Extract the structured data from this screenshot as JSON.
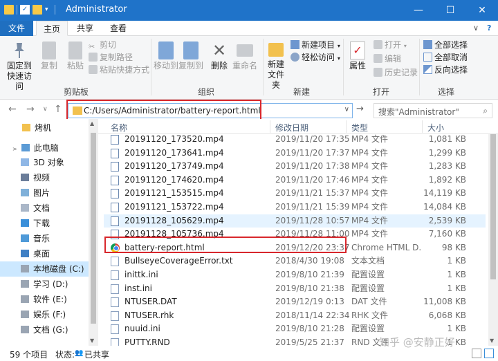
{
  "window": {
    "title": "Administrator",
    "minimize": "—",
    "maximize": "☐",
    "close": "✕"
  },
  "ribbon_tabs": {
    "file": "文件",
    "home": "主页",
    "share": "共享",
    "view": "查看",
    "collapse": "∨",
    "help": "?"
  },
  "ribbon": {
    "clipboard": {
      "label": "剪贴板",
      "pin": "固定到\n快速访问",
      "pin_l1": "固定到",
      "pin_l2": "快速访问",
      "copy": "复制",
      "paste": "粘贴",
      "cut": "剪切",
      "copy_path": "复制路径",
      "paste_shortcut": "粘贴快捷方式"
    },
    "organize": {
      "label": "组织",
      "move_to": "移动到",
      "copy_to": "复制到",
      "delete": "删除",
      "rename": "重命名"
    },
    "new": {
      "label": "新建",
      "new_folder_l1": "新建",
      "new_folder_l2": "文件夹",
      "new_item": "新建项目",
      "easy_access": "轻松访问"
    },
    "open": {
      "label": "打开",
      "properties": "属性",
      "open": "打开",
      "edit": "编辑",
      "history": "历史记录"
    },
    "select": {
      "label": "选择",
      "select_all": "全部选择",
      "select_none": "全部取消",
      "invert": "反向选择"
    }
  },
  "address": {
    "path": "C:/Users/Administrator/battery-report.html",
    "search_placeholder": "搜索\"Administrator\""
  },
  "nav_pane": [
    {
      "label": "烤机",
      "icon": "folder-icon"
    },
    {
      "label": "此电脑",
      "icon": "computer-icon"
    },
    {
      "label": "3D 对象",
      "icon": "3d-objects-icon"
    },
    {
      "label": "视频",
      "icon": "video-icon"
    },
    {
      "label": "图片",
      "icon": "pictures-icon"
    },
    {
      "label": "文档",
      "icon": "documents-icon"
    },
    {
      "label": "下载",
      "icon": "download-icon"
    },
    {
      "label": "音乐",
      "icon": "music-icon"
    },
    {
      "label": "桌面",
      "icon": "desktop-icon"
    },
    {
      "label": "本地磁盘 (C:)",
      "icon": "drive-icon"
    },
    {
      "label": "学习 (D:)",
      "icon": "drive-icon"
    },
    {
      "label": "软件 (E:)",
      "icon": "drive-icon"
    },
    {
      "label": "娱乐 (F:)",
      "icon": "drive-icon"
    },
    {
      "label": "文档 (G:)",
      "icon": "drive-icon"
    }
  ],
  "columns": {
    "name": "名称",
    "date": "修改日期",
    "type": "类型",
    "size": "大小"
  },
  "files": [
    {
      "name": "20191120_173520.mp4",
      "date": "2019/11/20 17:35",
      "type": "MP4 文件",
      "size": "1,081 KB"
    },
    {
      "name": "20191120_173641.mp4",
      "date": "2019/11/20 17:37",
      "type": "MP4 文件",
      "size": "1,299 KB"
    },
    {
      "name": "20191120_173749.mp4",
      "date": "2019/11/20 17:38",
      "type": "MP4 文件",
      "size": "1,283 KB"
    },
    {
      "name": "20191120_174620.mp4",
      "date": "2019/11/20 17:46",
      "type": "MP4 文件",
      "size": "1,892 KB"
    },
    {
      "name": "20191121_153515.mp4",
      "date": "2019/11/21 15:37",
      "type": "MP4 文件",
      "size": "14,119 KB"
    },
    {
      "name": "20191121_153722.mp4",
      "date": "2019/11/21 15:39",
      "type": "MP4 文件",
      "size": "14,084 KB"
    },
    {
      "name": "20191128_105629.mp4",
      "date": "2019/11/28 10:57",
      "type": "MP4 文件",
      "size": "2,539 KB"
    },
    {
      "name": "20191128_105736.mp4",
      "date": "2019/11/28 11:00",
      "type": "MP4 文件",
      "size": "7,160 KB"
    },
    {
      "name": "battery-report.html",
      "date": "2019/12/20 23:37",
      "type": "Chrome HTML D...",
      "size": "98 KB"
    },
    {
      "name": "BullseyeCoverageError.txt",
      "date": "2018/4/30 19:08",
      "type": "文本文档",
      "size": "1 KB"
    },
    {
      "name": "inittk.ini",
      "date": "2019/8/10 21:39",
      "type": "配置设置",
      "size": "1 KB"
    },
    {
      "name": "inst.ini",
      "date": "2019/8/10 21:38",
      "type": "配置设置",
      "size": "1 KB"
    },
    {
      "name": "NTUSER.DAT",
      "date": "2019/12/19 0:13",
      "type": "DAT 文件",
      "size": "11,008 KB"
    },
    {
      "name": "NTUSER.rhk",
      "date": "2018/11/14 22:34",
      "type": "RHK 文件",
      "size": "6,068 KB"
    },
    {
      "name": "nuuid.ini",
      "date": "2019/8/10 21:28",
      "type": "配置设置",
      "size": "1 KB"
    },
    {
      "name": "PUTTY.RND",
      "date": "2019/5/25 21:37",
      "type": "RND 文件",
      "size": "1 KB"
    }
  ],
  "status": {
    "count": "59 个项目",
    "state_label": "状态:",
    "state_value": "已共享"
  },
  "watermark": "知乎 @安静正好",
  "colors": {
    "titlebar": "#1f73c9",
    "selection": "#cce8ff",
    "highlight_box": "#d8272c"
  }
}
